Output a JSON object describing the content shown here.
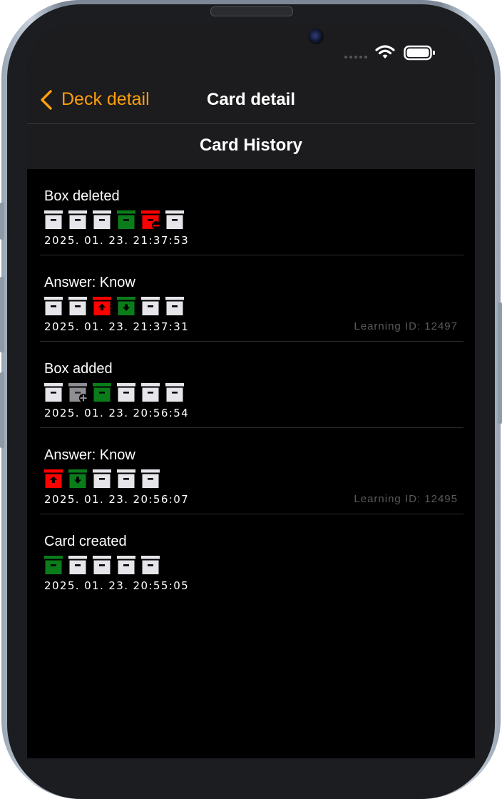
{
  "colors": {
    "accent": "#ff9f0a",
    "box_default": "#e5e5ea",
    "box_green": "#0a7d1a",
    "box_red": "#ff0000",
    "box_gray": "#8e8e93",
    "secondary_text": "#5a5a5e"
  },
  "nav": {
    "back_label": "Deck detail",
    "title": "Card detail",
    "subtitle": "Card History"
  },
  "history": [
    {
      "title": "Box deleted",
      "timestamp": "2025. 01. 23. 21:37:53",
      "learning_id": "",
      "boxes": [
        "default",
        "default",
        "default",
        "green",
        "red-minus",
        "default"
      ]
    },
    {
      "title": "Answer: Know",
      "timestamp": "2025. 01. 23. 21:37:31",
      "learning_id": "Learning ID: 12497",
      "boxes": [
        "default",
        "default",
        "red-up",
        "green-down",
        "default",
        "default"
      ]
    },
    {
      "title": "Box added",
      "timestamp": "2025. 01. 23. 20:56:54",
      "learning_id": "",
      "boxes": [
        "default",
        "gray-plus",
        "green",
        "default",
        "default",
        "default"
      ]
    },
    {
      "title": "Answer: Know",
      "timestamp": "2025. 01. 23. 20:56:07",
      "learning_id": "Learning ID: 12495",
      "boxes": [
        "red-up",
        "green-down",
        "default",
        "default",
        "default"
      ]
    },
    {
      "title": "Card created",
      "timestamp": "2025. 01. 23. 20:55:05",
      "learning_id": "",
      "boxes": [
        "green",
        "default",
        "default",
        "default",
        "default"
      ]
    }
  ]
}
